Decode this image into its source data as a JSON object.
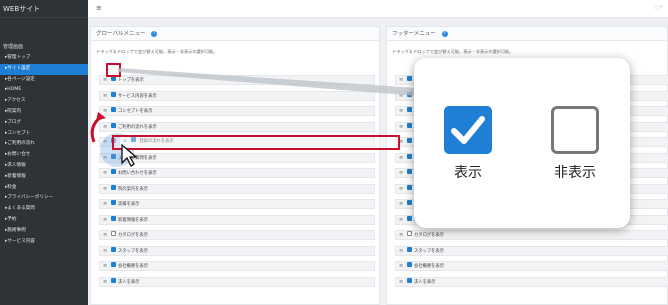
{
  "sidebar": {
    "brand": "WEBサイト",
    "section": "管理画面",
    "items": [
      "▸管理トップ",
      "▸サイト設定",
      "▸各ページ設定",
      "▸HOME",
      "▸アクセス",
      "▸院案内",
      "▸ブログ",
      "▸コンセプト",
      "▸ご利用の流れ",
      "▸お問い合せ",
      "▸求人情報",
      "▸新着情報",
      "▸料金",
      "▸プライバシーポリシー",
      "▸よくある質問",
      "▸予約",
      "▸施術事例",
      "▸サービス内容"
    ],
    "active_index": 1
  },
  "topbar": {
    "menu_icon": "≡",
    "right_text": "▢ ━"
  },
  "global_panel": {
    "title": "グローバルメニュー",
    "help": "?",
    "description": "ドラッグ＆ドロップで並び替え可能。表示・非表示の選択可能。",
    "rows": [
      {
        "label": "トップを表示",
        "checked": true
      },
      {
        "label": "サービス内容を表示",
        "checked": true
      },
      {
        "label": "コンセプトを表示",
        "checked": true
      },
      {
        "label": "ご利用の流れを表示",
        "checked": true
      },
      {
        "label": "",
        "checked": true
      },
      {
        "label": "よくある質問を表示",
        "checked": true
      },
      {
        "label": "お問い合わせを表示",
        "checked": true
      },
      {
        "label": "院の案内を表示",
        "checked": true
      },
      {
        "label": "実績を表示",
        "checked": true
      },
      {
        "label": "新着情報を表示",
        "checked": true
      },
      {
        "label": "カタログを表示",
        "checked": false
      },
      {
        "label": "スタッフを表示",
        "checked": true
      },
      {
        "label": "会社概要を表示",
        "checked": true
      },
      {
        "label": "求人を表示",
        "checked": true
      }
    ],
    "drag_row_label": "登録の流れを表示"
  },
  "footer_panel": {
    "title": "フッターメニュー",
    "help": "?",
    "description": "ドラッグ＆ドロップで並び替え可能。表示・非表示の選択可能。",
    "rows": [
      {
        "label": "",
        "checked": true
      },
      {
        "label": "",
        "checked": true
      },
      {
        "label": "",
        "checked": true
      },
      {
        "label": "",
        "checked": true
      },
      {
        "label": "",
        "checked": true
      },
      {
        "label": "",
        "checked": true
      },
      {
        "label": "",
        "checked": true
      },
      {
        "label": "",
        "checked": true
      },
      {
        "label": "",
        "checked": true
      },
      {
        "label": "新着情報を表示",
        "checked": true
      },
      {
        "label": "カタログを表示",
        "checked": false
      },
      {
        "label": "スタッフを表示",
        "checked": true
      },
      {
        "label": "会社概要を表示",
        "checked": true
      },
      {
        "label": "求人を表示",
        "checked": true
      }
    ]
  },
  "callout": {
    "show_label": "表示",
    "hide_label": "非表示"
  },
  "colors": {
    "accent": "#1f7fd4",
    "highlight": "#c8102e",
    "sidebar": "#2e3338"
  }
}
